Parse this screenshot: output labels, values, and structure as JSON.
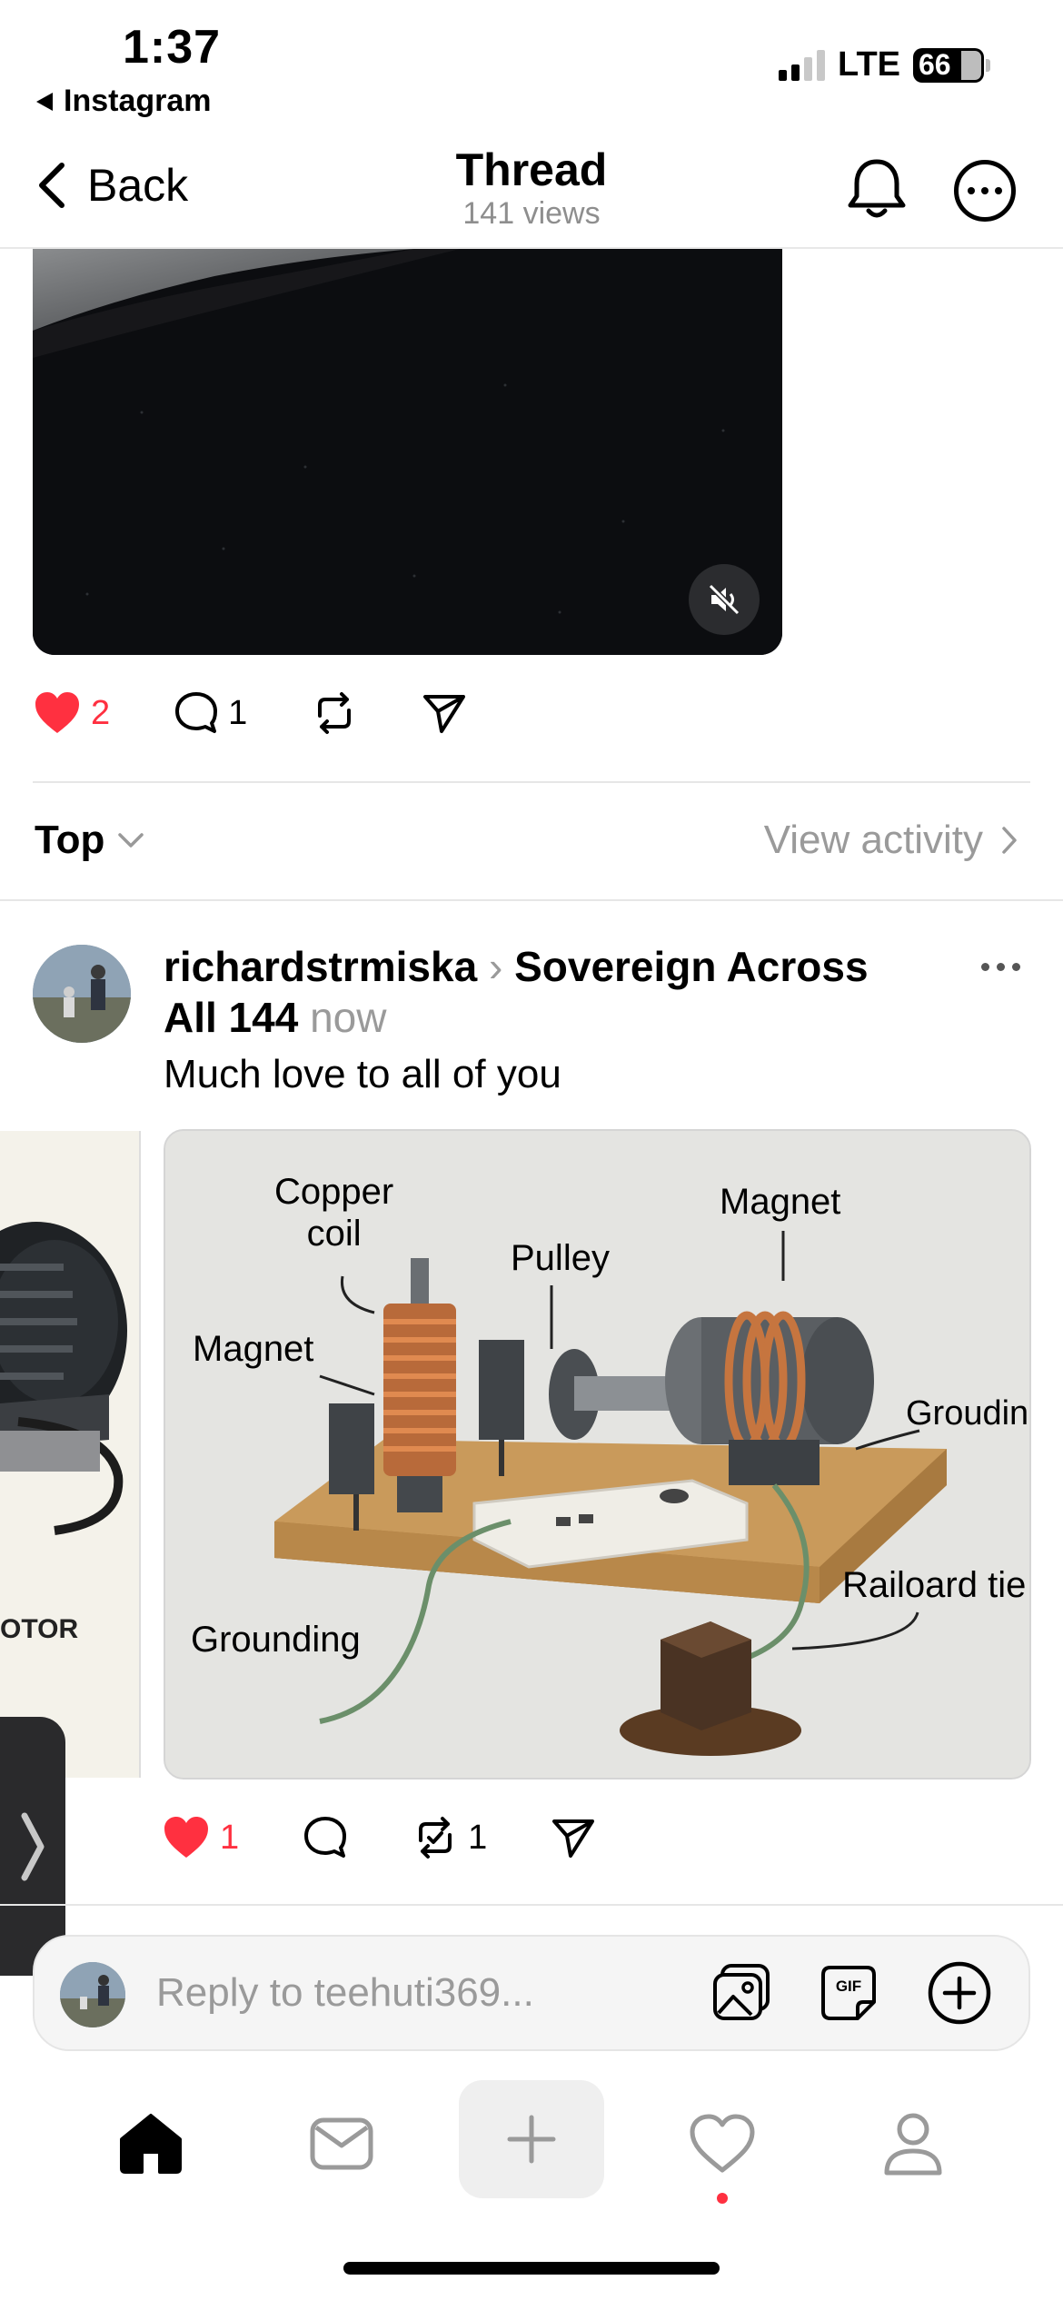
{
  "status_bar": {
    "time": "1:37",
    "back_app": "Instagram",
    "network": "LTE",
    "battery": "66"
  },
  "header": {
    "back_label": "Back",
    "title": "Thread",
    "subtitle": "141 views"
  },
  "original_post": {
    "likes": "2",
    "comments": "1"
  },
  "sort": {
    "label": "Top",
    "view_activity": "View activity"
  },
  "reply_post": {
    "author": "richardstrmiska",
    "community": "Sovereign Across All 144",
    "time": "now",
    "text": "Much love to all of you",
    "likes": "1",
    "reposts": "1",
    "diagram_labels": {
      "copper_coil_1": "Copper",
      "copper_coil_2": "coil",
      "magnet_top": "Magnet",
      "pulley": "Pulley",
      "magnet_left": "Magnet",
      "grounding_right": "Groudin",
      "railroad_tie": "Railoard tie",
      "grounding_left": "Grounding",
      "motor_fragment": "OTOR"
    }
  },
  "reply_bar": {
    "placeholder": "Reply to teehuti369..."
  },
  "colors": {
    "like_red": "#ff3040",
    "muted_text": "#9a9a9a"
  }
}
